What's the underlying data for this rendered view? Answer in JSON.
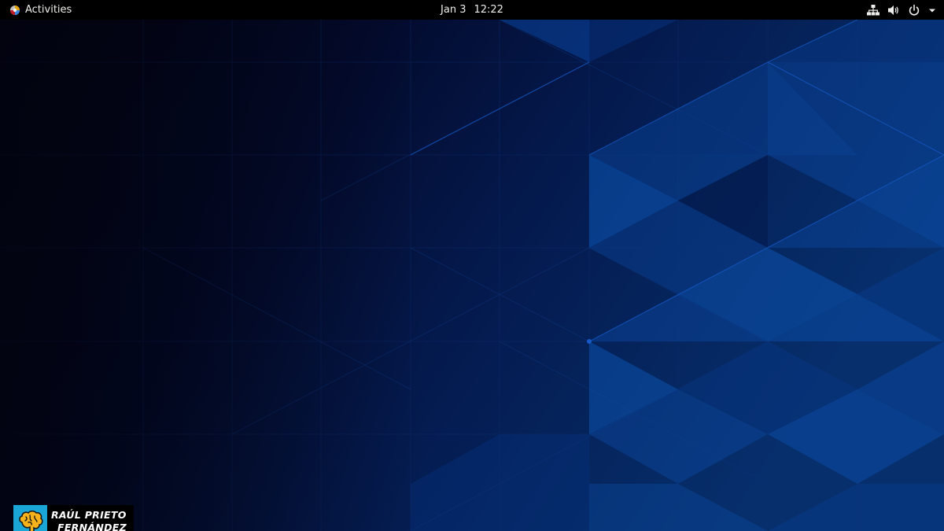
{
  "topbar": {
    "activities_label": "Activities",
    "date": "Jan 3",
    "time": "12:22",
    "icons": [
      "network-wired-icon",
      "volume-icon",
      "power-icon",
      "dropdown-arrow-icon"
    ],
    "bg_color": "#000000",
    "text_color": "#eeeeec"
  },
  "desktop": {
    "wallpaper": "blue-geometric-triangles",
    "colors": [
      "#020313",
      "#03092b",
      "#031a4f",
      "#0a4aa0"
    ]
  },
  "watermark": {
    "line1": "RAÚL PRIETO",
    "line2": "FERNÁNDEZ",
    "emblem_icon": "brain-icon",
    "emblem_color": "#1aa6d6",
    "brain_color": "#f5b21a"
  }
}
